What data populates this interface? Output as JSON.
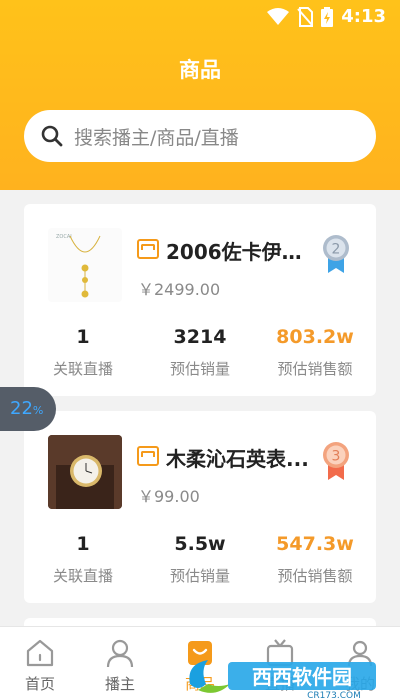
{
  "status_bar": {
    "time": "4:13"
  },
  "page": {
    "title": "商品"
  },
  "search": {
    "placeholder": "搜索播主/商品/直播"
  },
  "products": [
    {
      "name": "2006佐卡伊四...",
      "price": "￥2499.00",
      "rank": "2",
      "thumb_text": "ZOCAI",
      "stats": [
        {
          "value": "1",
          "label": "关联直播"
        },
        {
          "value": "3214",
          "label": "预估销量"
        },
        {
          "value": "803.2w",
          "label": "预估销售额"
        }
      ]
    },
    {
      "name": "木柔沁石英表...",
      "price": "￥99.00",
      "rank": "3",
      "stats": [
        {
          "value": "1",
          "label": "关联直播"
        },
        {
          "value": "5.5w",
          "label": "预估销量"
        },
        {
          "value": "547.3w",
          "label": "预估销售额"
        }
      ]
    }
  ],
  "float_badge": {
    "value": "22",
    "unit": "%"
  },
  "tabs": [
    {
      "label": "首页",
      "icon": "home-icon"
    },
    {
      "label": "播主",
      "icon": "person-icon"
    },
    {
      "label": "商品",
      "icon": "goods-icon",
      "active": true
    },
    {
      "label": "直播",
      "icon": "tv-icon"
    },
    {
      "label": "我的",
      "icon": "user-icon"
    }
  ],
  "watermark": {
    "text": "西西软件园",
    "url": "CR173.COM"
  },
  "colors": {
    "accent": "#f59a1a",
    "header": "#ffbb1e",
    "silver": "#9aa7b5",
    "bronze": "#f08a5d"
  }
}
